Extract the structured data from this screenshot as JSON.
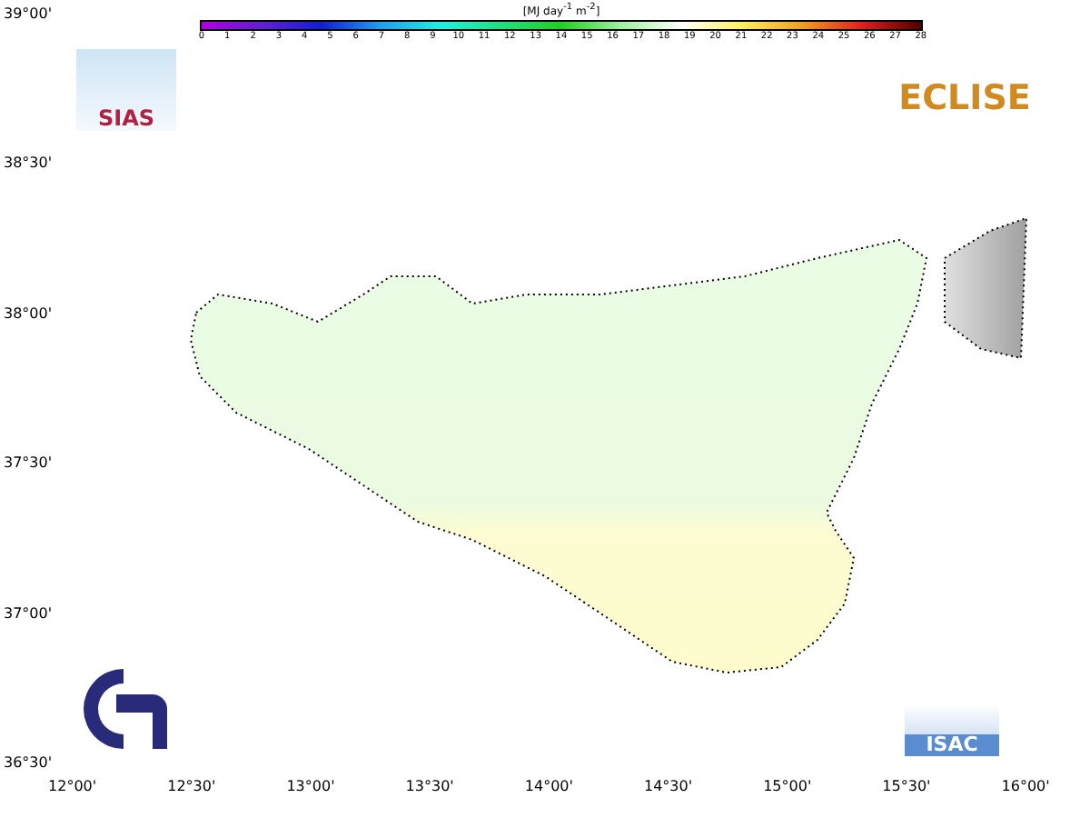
{
  "colorbar": {
    "title": "[MJ day$^{-1}$ m$^{-2}$]",
    "ticks": [
      "0",
      "1",
      "2",
      "3",
      "4",
      "5",
      "6",
      "7",
      "8",
      "9",
      "10",
      "11",
      "12",
      "13",
      "14",
      "15",
      "16",
      "17",
      "18",
      "19",
      "20",
      "21",
      "22",
      "23",
      "24",
      "25",
      "26",
      "27",
      "28"
    ]
  },
  "lat_labels": [
    "39°00'",
    "38°30'",
    "38°00'",
    "37°30'",
    "37°00'",
    "36°30'"
  ],
  "lon_labels": [
    "12°00'",
    "12°30'",
    "13°00'",
    "13°30'",
    "14°00'",
    "14°30'",
    "15°00'",
    "15°30'",
    "16°00'"
  ],
  "logos": {
    "top_left": "SIAS",
    "top_right": "ECLISE",
    "bottom_right": "ISAC"
  }
}
